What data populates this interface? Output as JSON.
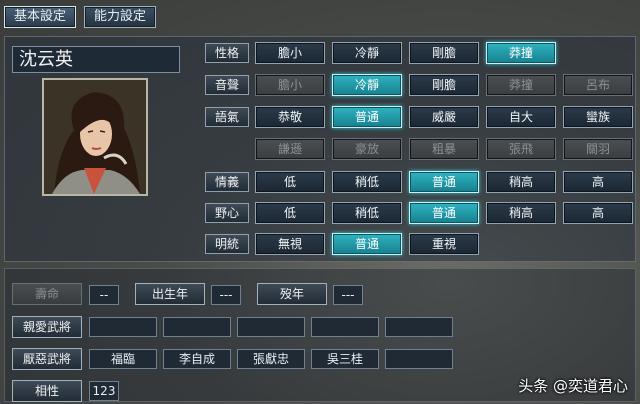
{
  "tabs": [
    {
      "label": "基本設定",
      "active": true
    },
    {
      "label": "能力設定",
      "active": false
    }
  ],
  "character": {
    "name": "沈云英"
  },
  "rows": {
    "personality": {
      "label": "性格",
      "options": [
        {
          "label": "膽小",
          "state": "normal"
        },
        {
          "label": "冷靜",
          "state": "normal"
        },
        {
          "label": "剛膽",
          "state": "normal"
        },
        {
          "label": "莽撞",
          "state": "selected"
        }
      ]
    },
    "voice": {
      "label": "音聲",
      "options": [
        {
          "label": "膽小",
          "state": "disabled"
        },
        {
          "label": "冷靜",
          "state": "selected"
        },
        {
          "label": "剛膽",
          "state": "normal"
        },
        {
          "label": "莽撞",
          "state": "disabled"
        },
        {
          "label": "呂布",
          "state": "disabled"
        }
      ]
    },
    "tone": {
      "label": "語氣",
      "options": [
        {
          "label": "恭敬",
          "state": "normal"
        },
        {
          "label": "普通",
          "state": "selected"
        },
        {
          "label": "威嚴",
          "state": "normal"
        },
        {
          "label": "自大",
          "state": "normal"
        },
        {
          "label": "蠻族",
          "state": "normal"
        }
      ]
    },
    "tone_extra": {
      "options": [
        {
          "label": "謙遜",
          "state": "disabled"
        },
        {
          "label": "豪放",
          "state": "disabled"
        },
        {
          "label": "粗暴",
          "state": "disabled"
        },
        {
          "label": "張飛",
          "state": "disabled"
        },
        {
          "label": "關羽",
          "state": "disabled"
        }
      ]
    },
    "loyalty": {
      "label": "情義",
      "options": [
        {
          "label": "低",
          "state": "normal"
        },
        {
          "label": "稍低",
          "state": "normal"
        },
        {
          "label": "普通",
          "state": "selected"
        },
        {
          "label": "稍高",
          "state": "normal"
        },
        {
          "label": "高",
          "state": "normal"
        }
      ]
    },
    "ambition": {
      "label": "野心",
      "options": [
        {
          "label": "低",
          "state": "normal"
        },
        {
          "label": "稍低",
          "state": "normal"
        },
        {
          "label": "普通",
          "state": "selected"
        },
        {
          "label": "稍高",
          "state": "normal"
        },
        {
          "label": "高",
          "state": "normal"
        }
      ]
    },
    "dynasty": {
      "label": "明統",
      "options": [
        {
          "label": "無視",
          "state": "normal"
        },
        {
          "label": "普通",
          "state": "selected"
        },
        {
          "label": "重視",
          "state": "normal"
        }
      ]
    }
  },
  "lifespan": {
    "label": "壽命",
    "value": "--"
  },
  "birth": {
    "label": "出生年",
    "value": "---"
  },
  "death": {
    "label": "歿年",
    "value": "---"
  },
  "friends": {
    "label": "親愛武將",
    "values": [
      "",
      "",
      "",
      "",
      ""
    ]
  },
  "enemies": {
    "label": "厭惡武將",
    "values": [
      "福臨",
      "李自成",
      "張獻忠",
      "吳三桂",
      ""
    ]
  },
  "affinity": {
    "label": "相性",
    "value": "123"
  },
  "watermark": "头条 @奕道君心",
  "colors": {
    "selected": "#2fb3c2",
    "panel": "#26303a"
  }
}
